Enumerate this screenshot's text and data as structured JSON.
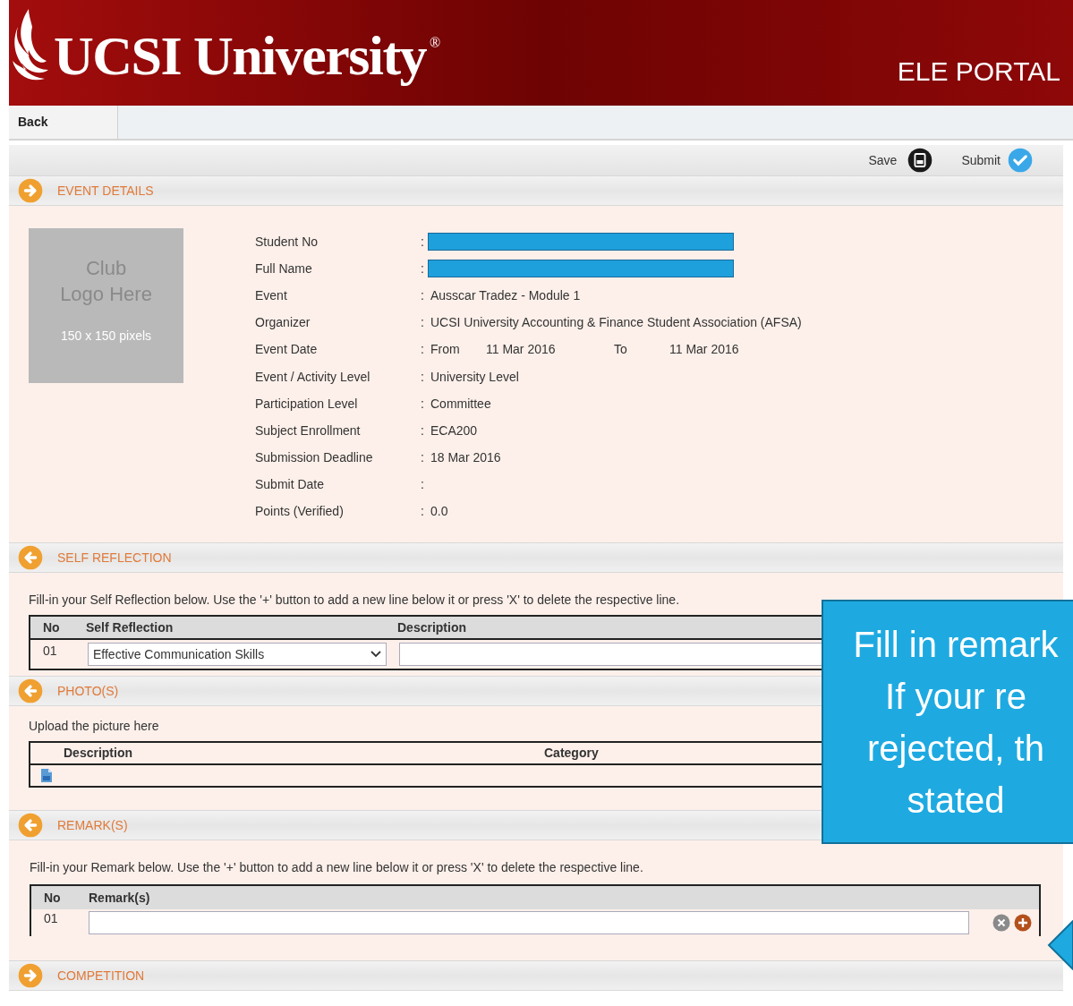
{
  "header": {
    "logo_text": "UCSI University",
    "registered_mark": "®",
    "portal": "ELE PORTAL"
  },
  "nav": {
    "back": "Back"
  },
  "toolbar": {
    "save": "Save",
    "submit": "Submit"
  },
  "event_details": {
    "title": "EVENT DETAILS",
    "arrow_right": true,
    "logo_placeholder": {
      "title_lines": [
        "Club",
        "Logo Here"
      ],
      "size": "150 x 150 pixels"
    },
    "fields": [
      {
        "kind": "redacted",
        "label": "Student No",
        "separator": ":"
      },
      {
        "kind": "redacted",
        "label": "Full Name",
        "separator": ":"
      },
      {
        "kind": "text",
        "label": "Event",
        "separator": ":",
        "value": "Ausscar Tradez - Module 1"
      },
      {
        "kind": "text",
        "label": "Organizer",
        "separator": ":",
        "value": "UCSI University Accounting & Finance Student Association (AFSA)"
      },
      {
        "kind": "range",
        "label": "Event Date",
        "separator": ":",
        "from_label": "From",
        "from": "11 Mar 2016",
        "to_label": "To",
        "to": "11 Mar 2016"
      },
      {
        "kind": "text",
        "label": "Event / Activity Level",
        "separator": ":",
        "value": "University Level"
      },
      {
        "kind": "text",
        "label": "Participation Level",
        "separator": ":",
        "value": "Committee"
      },
      {
        "kind": "text",
        "label": "Subject Enrollment",
        "separator": ":",
        "value": "ECA200"
      },
      {
        "kind": "text",
        "label": "Submission Deadline",
        "separator": ":",
        "value": "18 Mar 2016"
      },
      {
        "kind": "empty",
        "label": "Submit Date",
        "separator": ":"
      },
      {
        "kind": "text",
        "label": "Points (Verified)",
        "separator": ":",
        "value": "0.0"
      }
    ]
  },
  "self_reflection": {
    "title": "SELF REFLECTION",
    "arrow_right": false,
    "instruction": "Fill-in your Self Reflection below. Use the '+' button to add a new line below it or press 'X' to delete the respective line.",
    "columns": [
      "No",
      "Self Reflection",
      "Description"
    ],
    "rows": [
      {
        "no": "01",
        "selection": "Effective Communication Skills"
      }
    ]
  },
  "photos": {
    "title": "PHOTO(S)",
    "arrow_right": false,
    "instruction": "Upload the picture here",
    "columns": [
      "Description",
      "Category"
    ]
  },
  "remarks": {
    "title": "REMARK(S)",
    "arrow_right": false,
    "instruction": "Fill-in your Remark below. Use the '+' button to add a new line below it or press 'X' to delete the respective line.",
    "columns": [
      "No",
      "Remark(s)"
    ],
    "rows": [
      {
        "no": "01"
      }
    ]
  },
  "competition": {
    "title": "COMPETITION",
    "arrow_right": true
  },
  "callout": {
    "lines": [
      "Fill in remark",
      "If your re",
      "rejected, th",
      "stated"
    ]
  }
}
